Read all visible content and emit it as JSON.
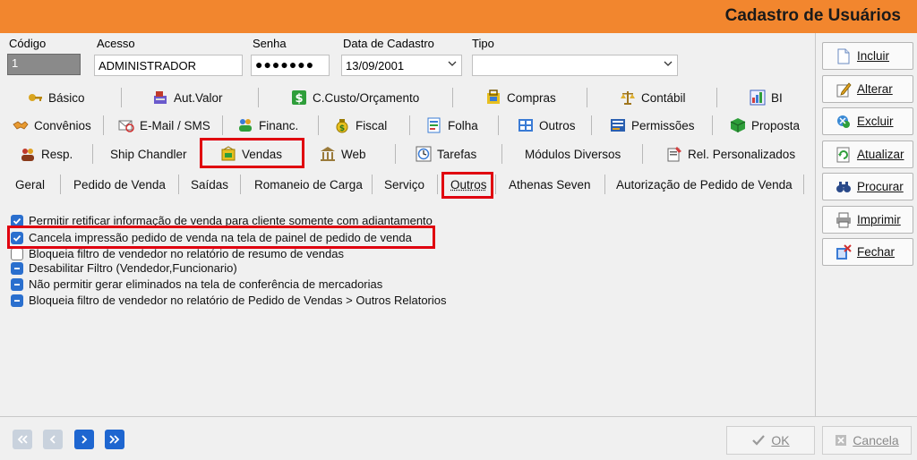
{
  "window": {
    "title": "Cadastro de Usuários"
  },
  "form": {
    "codigo": {
      "label": "Código",
      "value": "1"
    },
    "acesso": {
      "label": "Acesso",
      "value": "ADMINISTRADOR"
    },
    "senha": {
      "label": "Senha",
      "value": "●●●●●●●"
    },
    "data_cadastro": {
      "label": "Data de Cadastro",
      "value": "13/09/2001"
    },
    "tipo": {
      "label": "Tipo",
      "value": ""
    }
  },
  "tabs_row1": [
    "Básico",
    "Aut.Valor",
    "C.Custo/Orçamento",
    "Compras",
    "Contábil",
    "BI"
  ],
  "tabs_row2": [
    "Convênios",
    "E-Mail / SMS",
    "Financ.",
    "Fiscal",
    "Folha",
    "Outros",
    "Permissões",
    "Proposta"
  ],
  "tabs_row3": [
    "Resp.",
    "Ship Chandler",
    "Vendas",
    "Web",
    "Tarefas",
    "Módulos Diversos",
    "Rel. Personalizados"
  ],
  "subtabs": [
    "Geral",
    "Pedido de Venda",
    "Saídas",
    "Romaneio de Carga",
    "Serviço",
    "Outros",
    "Athenas Seven",
    "Autorização de Pedido de Venda"
  ],
  "options": [
    {
      "label": "Permitir retificar informação de venda para cliente somente com adiantamento",
      "state": "checked"
    },
    {
      "label": "Cancela impressão pedido de venda na tela de painel de pedido de venda",
      "state": "checked"
    },
    {
      "label": "Bloqueia filtro de vendedor no relatório de resumo de vendas",
      "state": "unchecked"
    },
    {
      "label": "Desabilitar Filtro (Vendedor,Funcionario)",
      "state": "indeterminate"
    },
    {
      "label": "Não permitir gerar eliminados na tela de conferência de mercadorias",
      "state": "indeterminate"
    },
    {
      "label": "Bloqueia filtro de vendedor no relatório de Pedido de Vendas > Outros Relatorios",
      "state": "indeterminate"
    }
  ],
  "actions": [
    "Incluir",
    "Alterar",
    "Excluir",
    "Atualizar",
    "Procurar",
    "Imprimir",
    "Fechar"
  ],
  "footer": {
    "ok": "OK",
    "cancel": "Cancela"
  },
  "colors": {
    "title_bar": "#f2862e",
    "highlight": "#e0000f",
    "checkbox": "#2a6fce"
  }
}
